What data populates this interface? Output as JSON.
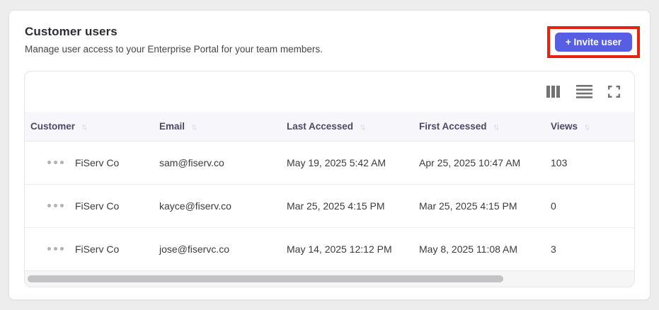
{
  "page": {
    "title": "Customer users",
    "subtitle": "Manage user access to your Enterprise Portal for your team members."
  },
  "actions": {
    "invite_label": "+ Invite user",
    "highlight_color": "#e8230d",
    "button_color": "#575ee1"
  },
  "toolbar": {
    "icons": [
      "columns-icon",
      "row-density-icon",
      "fullscreen-icon"
    ],
    "icon_color": "#737376"
  },
  "table": {
    "columns": [
      {
        "label": "Customer",
        "sortable": true
      },
      {
        "label": "Email",
        "sortable": true
      },
      {
        "label": "Last Accessed",
        "sortable": true
      },
      {
        "label": "First Accessed",
        "sortable": true
      },
      {
        "label": "Views",
        "sortable": true
      }
    ],
    "sort_glyph": "↑↓",
    "rows": [
      {
        "customer": "FiServ Co",
        "email": "sam@fiserv.co",
        "last_accessed": "May 19, 2025 5:42 AM",
        "first_accessed": "Apr 25, 2025 10:47 AM",
        "views": "103"
      },
      {
        "customer": "FiServ Co",
        "email": "kayce@fiserv.co",
        "last_accessed": "Mar 25, 2025 4:15 PM",
        "first_accessed": "Mar 25, 2025 4:15 PM",
        "views": "0"
      },
      {
        "customer": "FiServ Co",
        "email": "jose@fiservc.co",
        "last_accessed": "May 14, 2025 12:12 PM",
        "first_accessed": "May 8, 2025 11:08 AM",
        "views": "3"
      }
    ],
    "header_bg": "#f7f7fb",
    "header_text_color": "#4a4a67"
  },
  "scrollbar": {
    "thumb_percent": 78
  }
}
